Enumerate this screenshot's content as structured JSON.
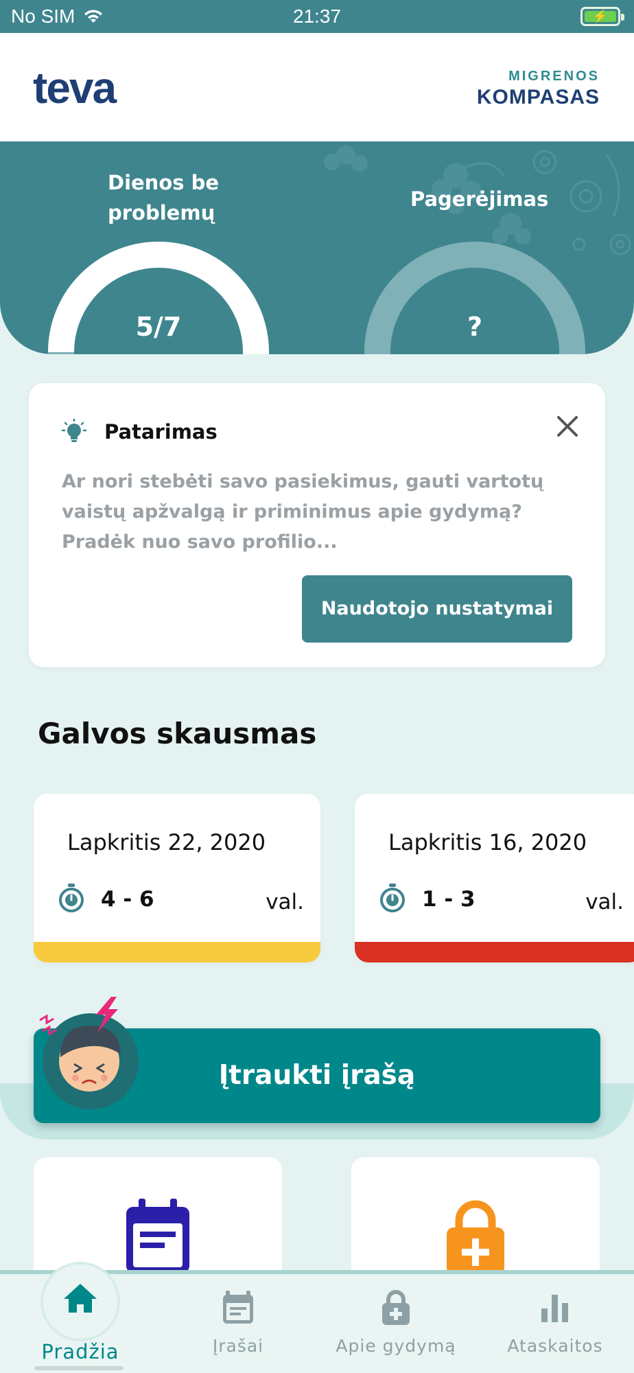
{
  "status_bar": {
    "carrier": "No SIM",
    "time": "21:37"
  },
  "header": {
    "logo_text": "teva",
    "brand_top": "MIGRENOS",
    "brand_bottom": "KOMPASAS"
  },
  "stats": {
    "days_without_problems": {
      "label": "Dienos be problemų",
      "value": "5/7",
      "fraction": 0.714
    },
    "improvement": {
      "label": "Pagerėjimas",
      "value": "?"
    }
  },
  "tip": {
    "title": "Patarimas",
    "text": "Ar nori stebėti savo pasiekimus, gauti vartotų vaistų apžvalgą ir priminimus apie gydymą? Pradėk nuo savo profilio...",
    "button_label": "Naudotojo nustatymai",
    "icon": "lightbulb-icon",
    "close_icon": "close-icon"
  },
  "headaches": {
    "title": "Galvos skausmas",
    "items": [
      {
        "date": "Lapkritis 22, 2020",
        "duration": "4 - 6",
        "unit": "val.",
        "severity_color": "#f8ca3e"
      },
      {
        "date": "Lapkritis 16, 2020",
        "duration": "1 - 3",
        "unit": "val.",
        "severity_color": "#d93124"
      }
    ]
  },
  "add_entry": {
    "label": "Įtraukti įrašą"
  },
  "tiles": [
    {
      "icon": "calendar-icon",
      "color": "#2a1fa8"
    },
    {
      "icon": "lock-plus-icon",
      "color": "#f7941d"
    }
  ],
  "nav": {
    "items": [
      {
        "label": "Pradžia",
        "icon": "home-icon",
        "active": true
      },
      {
        "label": "Įrašai",
        "icon": "list-icon",
        "active": false
      },
      {
        "label": "Apie gydymą",
        "icon": "lock-plus-icon",
        "active": false
      },
      {
        "label": "Ataskaitos",
        "icon": "bar-chart-icon",
        "active": false
      }
    ]
  },
  "colors": {
    "primary": "#3f858e",
    "accent": "#00878a",
    "background": "#e4f3f1"
  }
}
